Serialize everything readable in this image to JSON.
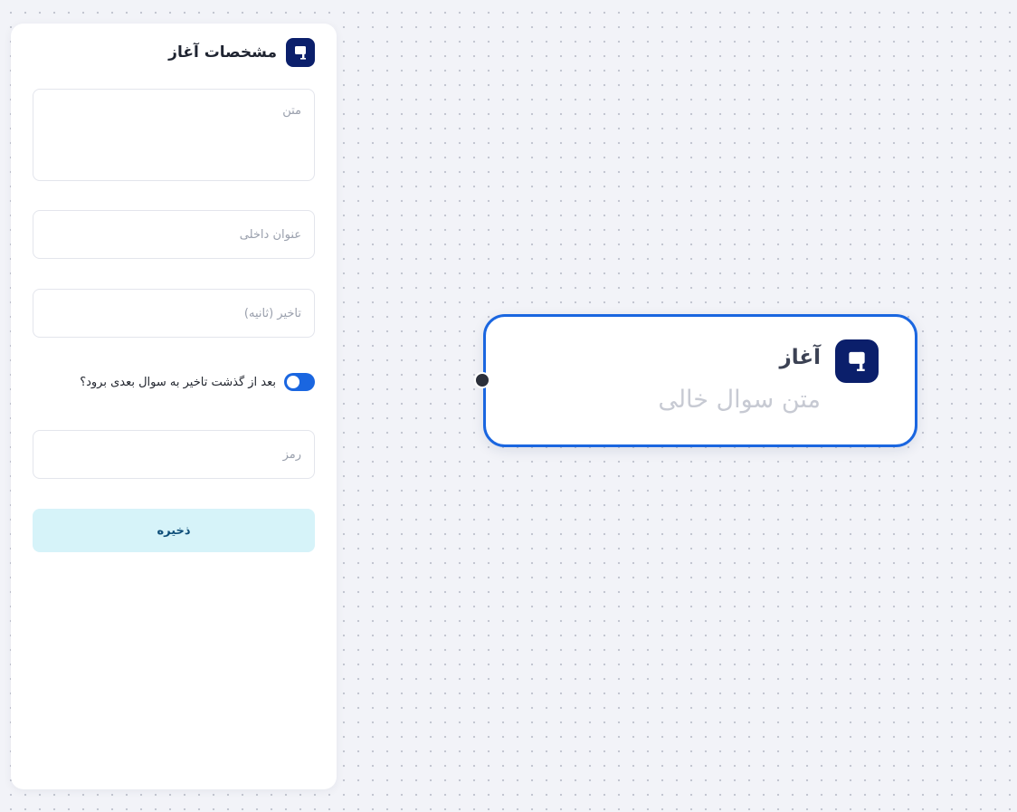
{
  "panel": {
    "title": "مشخصات آغاز",
    "icon": "flag-icon",
    "fields": {
      "text_placeholder": "متن",
      "text_value": "",
      "internal_title_placeholder": "عنوان داخلی",
      "internal_title_value": "",
      "delay_placeholder": "تاخیر (ثانیه)",
      "delay_value": "",
      "password_placeholder": "رمز",
      "password_value": ""
    },
    "toggle": {
      "label": "بعد از گذشت تاخیر به سوال بعدی برود؟",
      "state": "on"
    },
    "save_label": "ذخیره"
  },
  "node": {
    "title": "آغاز",
    "subtitle": "متن سوال خالی",
    "icon": "flag-icon"
  },
  "colors": {
    "accent": "#1a66e0",
    "icon_bg": "#0b1f6b",
    "save_bg": "#d6f3f9",
    "save_text": "#0d4d78",
    "canvas_bg": "#f2f3f8"
  }
}
